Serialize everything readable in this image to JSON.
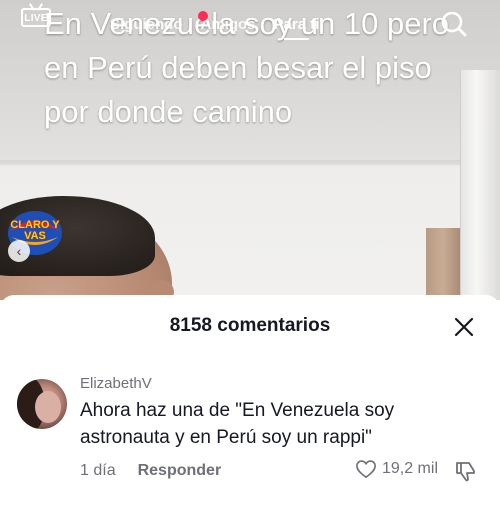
{
  "video": {
    "caption": "En Venezuela soy un 10 pero en Perú deben besar el piso por donde camino",
    "badge_text": "CLARO Y VAS"
  },
  "top_bar": {
    "live_label": "LIVE",
    "tabs": [
      {
        "label": "Siguiendo"
      },
      {
        "label": "Amigos"
      },
      {
        "label": "Para ti"
      }
    ],
    "colors": {
      "notification": "#fe2c55"
    }
  },
  "comments": {
    "header": "8158 comentarios",
    "items": [
      {
        "username": "ElizabethV",
        "text": "Ahora haz una de \"En Venezuela soy astronauta y en Perú soy un rappi\"",
        "time": "1 día",
        "reply_label": "Responder",
        "likes": "19,2 mil"
      }
    ]
  },
  "icons": {
    "live": "live-tv-icon",
    "search": "search-icon",
    "close": "close-icon",
    "like": "heart-icon",
    "dislike": "thumbs-down-icon"
  }
}
